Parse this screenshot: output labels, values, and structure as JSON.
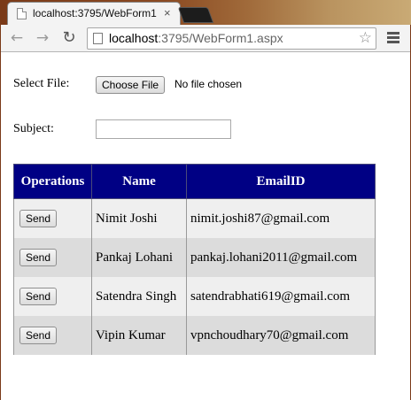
{
  "browser": {
    "tab_title": "localhost:3795/WebForm1",
    "tab_close": "×",
    "url_host": "localhost",
    "url_rest": ":3795/WebForm1.aspx",
    "back_icon": "←",
    "forward_icon": "→",
    "reload_icon": "↻",
    "star_icon": "☆"
  },
  "form": {
    "select_file_label": "Select File:",
    "choose_file_button": "Choose File",
    "file_status": "No file chosen",
    "subject_label": "Subject:",
    "subject_value": ""
  },
  "table": {
    "headers": [
      "Operations",
      "Name",
      "EmailID"
    ],
    "rows": [
      {
        "action": "Send",
        "name": "Nimit Joshi",
        "email": "nimit.joshi87@gmail.com"
      },
      {
        "action": "Send",
        "name": "Pankaj Lohani",
        "email": "pankaj.lohani2011@gmail.com"
      },
      {
        "action": "Send",
        "name": "Satendra Singh",
        "email": "satendrabhati619@gmail.com"
      },
      {
        "action": "Send",
        "name": "Vipin Kumar",
        "email": "vpnchoudhary70@gmail.com"
      }
    ]
  },
  "colors": {
    "header_bg": "#000084",
    "row_odd": "#efefef",
    "row_even": "#dcdcdc"
  }
}
